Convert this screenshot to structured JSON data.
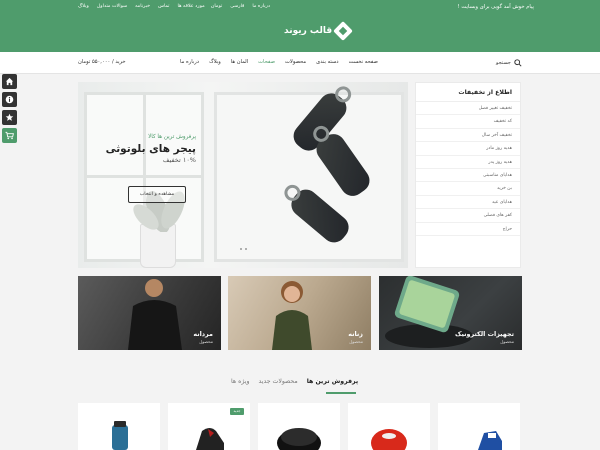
{
  "colors": {
    "brand": "#4f9c6c",
    "dark": "#333333"
  },
  "topbar": {
    "welcome": "پیام خوش آمد گویی برای وبسایت !",
    "links_left": [
      "مورد علاقه ها",
      "تماس",
      "خبرنامه",
      "سوالات متداول",
      "وبلاگ"
    ],
    "links_right": [
      "درباره ما",
      "فارسی",
      "تومان"
    ],
    "logo_text": "قالب ریوند"
  },
  "nav": {
    "search_label": "جستجو",
    "menu": [
      "صفحه نخست",
      "دسته بندی",
      "محصولات",
      "صفحات",
      "المان ها",
      "وبلاگ",
      "درباره ما"
    ],
    "active_index": 3,
    "cart_label": "خرید / ۵۵۰,۰۰۰ تومان"
  },
  "side_buttons": [
    "home-icon",
    "info-icon",
    "star-icon",
    "cart-icon"
  ],
  "offers": {
    "title": "اطلاع از تخفیفات",
    "items": [
      "تخفیف تغییر فصل",
      "کد تخفیف",
      "تخفیف آخر سال",
      "هدیه روز مادر",
      "هدیه روز پدر",
      "هدایای مناسبتی",
      "بن خرید",
      "هدایای عید",
      "کفر های فصلی",
      "حراج"
    ]
  },
  "hero": {
    "kicker": "پرفروش ترین ها کالا",
    "headline": "پیجر های بلوتوثی",
    "discount": "۱۰% تخفیف",
    "cta": "مشاهده و انتخاب"
  },
  "categories": [
    {
      "title": "تجهیزات الکترونیک",
      "sub": "محصول"
    },
    {
      "title": "زنانه",
      "sub": "محصول"
    },
    {
      "title": "مردانه",
      "sub": "محصول"
    }
  ],
  "product_tabs": [
    "پرفروش ترین ها",
    "محصولات جدید",
    "ویژه ها"
  ],
  "product_badge": "جدید"
}
